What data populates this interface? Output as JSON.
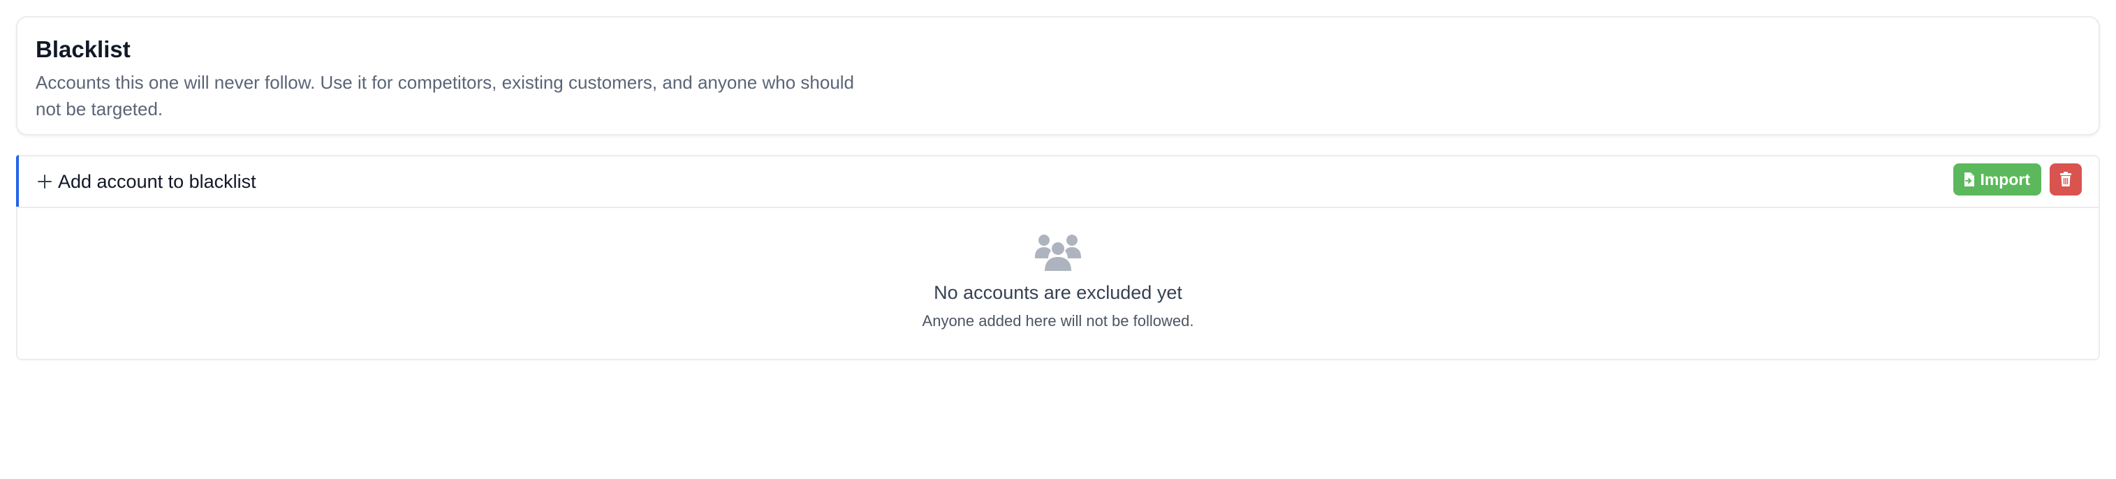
{
  "header": {
    "title": "Blacklist",
    "description": "Accounts this one will never follow. Use it for competitors, existing customers, and anyone who should not be targeted."
  },
  "toolbar": {
    "add_label": "Add account to blacklist",
    "add_icon": "plus-icon",
    "import_label": "Import",
    "import_icon": "file-import-icon",
    "delete_icon": "trash-icon",
    "colors": {
      "accent": "#2563eb",
      "import": "#5cb85c",
      "delete": "#d9534f"
    }
  },
  "empty_state": {
    "icon": "users-icon",
    "title": "No accounts are excluded yet",
    "subtitle": "Anyone added here will not be followed."
  }
}
